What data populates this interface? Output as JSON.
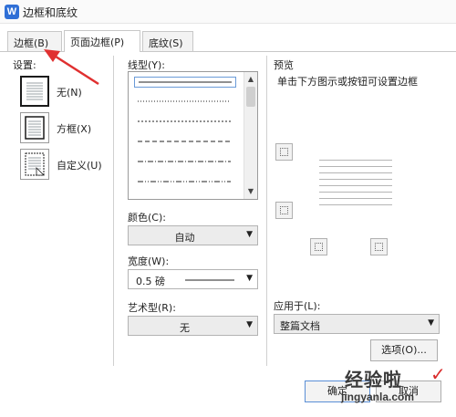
{
  "window": {
    "title": "边框和底纹",
    "icon": "wps-writer-icon"
  },
  "tabs": [
    {
      "label": "边框(B)"
    },
    {
      "label": "页面边框(P)"
    },
    {
      "label": "底纹(S)"
    }
  ],
  "active_tab": "页面边框(P)",
  "settings": {
    "label": "设置:",
    "items": [
      {
        "label": "无(N)",
        "icon": "border-none-icon",
        "selected": true
      },
      {
        "label": "方框(X)",
        "icon": "border-box-icon",
        "selected": false
      },
      {
        "label": "自定义(U)",
        "icon": "border-custom-icon",
        "selected": false
      }
    ]
  },
  "line_style": {
    "label": "线型(Y):"
  },
  "color": {
    "label": "颜色(C):",
    "value": "自动"
  },
  "width": {
    "label": "宽度(W):",
    "value": "0.5  磅"
  },
  "art": {
    "label": "艺术型(R):",
    "value": "无"
  },
  "preview": {
    "label": "预览",
    "hint": "单击下方图示或按钮可设置边框"
  },
  "apply_to": {
    "label": "应用于(L):",
    "value": "整篇文档"
  },
  "buttons": {
    "options": "选项(O)...",
    "ok": "确定",
    "cancel": "取消"
  },
  "watermark": {
    "text": "经验啦",
    "url_text": "jingyanla.com"
  },
  "colors": {
    "accent": "#2f6fd6",
    "arrow": "#e03030",
    "check": "#d92b2b"
  }
}
